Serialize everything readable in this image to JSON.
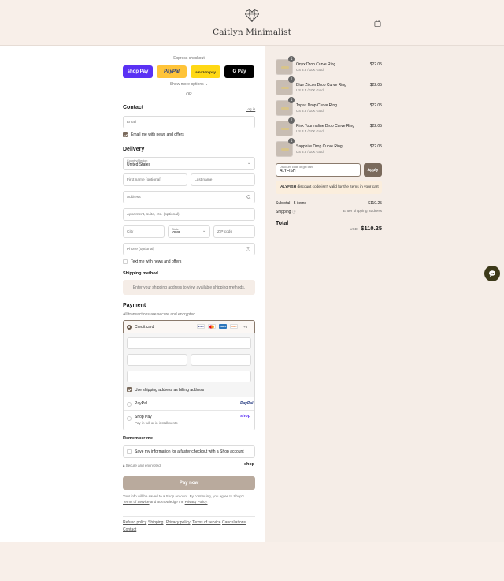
{
  "header": {
    "brand": "Caitlyn Minimalist",
    "logo_icon": "diamond-heart-logo",
    "cart_icon": "shopping-bag-icon"
  },
  "express": {
    "label": "Express checkout",
    "buttons": [
      "shop Pay",
      "PayPal",
      "amazon pay",
      "G Pay"
    ],
    "show_more": "Show more options",
    "or": "OR"
  },
  "contact": {
    "title": "Contact",
    "login": "Log in",
    "email_placeholder": "Email",
    "news_label": "Email me with news and offers",
    "news_checked": true
  },
  "delivery": {
    "title": "Delivery",
    "country_label": "Country/Region",
    "country_value": "United States",
    "first_name": "First name (optional)",
    "last_name": "Last name",
    "address": "Address",
    "apartment": "Apartment, suite, etc. (optional)",
    "city": "City",
    "state_label": "State",
    "state_value": "Iowa",
    "zip": "ZIP code",
    "phone": "Phone (optional)",
    "text_label": "Text me with news and offers"
  },
  "shipping": {
    "title": "Shipping method",
    "message": "Enter your shipping address to view available shipping methods."
  },
  "payment": {
    "title": "Payment",
    "subtitle": "All transactions are secure and encrypted.",
    "credit_card": "Credit card",
    "card_brands": [
      "VISA",
      "MC",
      "AMEX",
      "DISC",
      "+6"
    ],
    "billing_label": "Use shipping address as billing address",
    "paypal": "PayPal",
    "paypal_logo": "PayPal",
    "shop_pay": "Shop Pay",
    "shop_pay_sub": "Pay in full or in installments",
    "shop_logo": "shop"
  },
  "remember": {
    "title": "Remember me",
    "label": "Save my information for a faster checkout with a Shop account",
    "secure": "Secure and encrypted",
    "shop_logo": "shop"
  },
  "pay_button": "Pay now",
  "legal": {
    "line1": "Your info will be saved to a Shop account. By continuing, you agree to Shop's",
    "terms": "Terms of Service",
    "and": "and acknowledge the",
    "privacy": "Privacy Policy."
  },
  "footer": [
    "Refund policy",
    "Shipping",
    "Privacy policy",
    "Terms of service",
    "Cancellations",
    "Contact"
  ],
  "order": {
    "items": [
      {
        "name": "Onyx Drop Curve Ring",
        "variant": "US 3.5 / 10K Gold",
        "price": "$22.05",
        "qty": "1"
      },
      {
        "name": "Blue Zircon Drop Curve Ring",
        "variant": "US 3.5 / 10K Gold",
        "price": "$22.05",
        "qty": "1"
      },
      {
        "name": "Topaz Drop Curve Ring",
        "variant": "US 3.5 / 10K Gold",
        "price": "$22.05",
        "qty": "1"
      },
      {
        "name": "Pink Tourmaline Drop Curve Ring",
        "variant": "US 3.5 / 10K Gold",
        "price": "$22.05",
        "qty": "1"
      },
      {
        "name": "Sapphire Drop Curve Ring",
        "variant": "US 3.5 / 10K Gold",
        "price": "$22.05",
        "qty": "1"
      }
    ],
    "discount_label": "Discount code or gift card",
    "discount_value": "ALYFISH",
    "apply": "Apply",
    "error_code": "ALYFISH",
    "error_text": "discount code isn't valid for the items in your cart",
    "subtotal_label": "Subtotal · 5 items",
    "subtotal_value": "$110.25",
    "shipping_label": "Shipping",
    "shipping_value": "Enter shipping address",
    "total_label": "Total",
    "currency": "USD",
    "total_value": "$110.25"
  },
  "chat_icon": "chat-bubble-icon"
}
